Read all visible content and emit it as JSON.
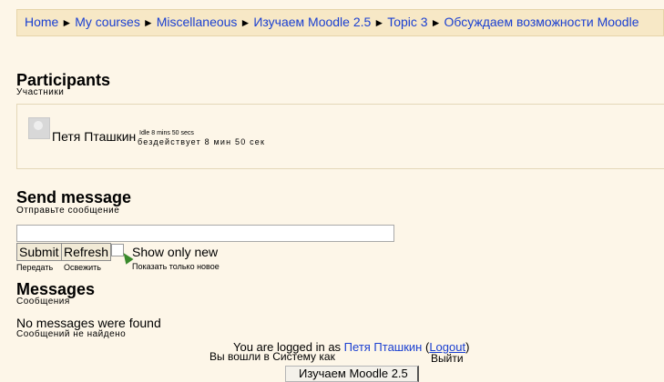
{
  "breadcrumb": {
    "items": [
      "Home",
      "My courses",
      "Miscellaneous",
      "Изучаем Moodle 2.5",
      "Topic 3",
      "Обсуждаем возможности Moodle"
    ],
    "separator": "►"
  },
  "participants": {
    "title": "Participants",
    "subtitle": "Участники",
    "users": [
      {
        "name": "Петя Пташкин",
        "idle": "Idle 8 mins 50 secs",
        "idle_ru": "бездействует 8 мин 50 сек"
      }
    ]
  },
  "send_message": {
    "title": "Send message",
    "subtitle": "Отправьте сообщение",
    "input_value": "",
    "submit_label": "Submit",
    "submit_sub": "Передать",
    "refresh_label": "Refresh",
    "refresh_sub": "Освежить",
    "show_only_new_label": "Show only new",
    "show_only_new_sub": "Показать только новое",
    "show_only_new_checked": false
  },
  "messages": {
    "title": "Messages",
    "subtitle": "Сообщения",
    "empty_text": "No messages were found",
    "empty_text_ru": "Сообщений не найдено"
  },
  "footer": {
    "logged_in_prefix": "You are logged in as ",
    "user_name": "Петя Пташкин",
    "logout_label": "Logout",
    "logged_in_ru": "Вы вошли в Систему как",
    "logout_ru": "Выйти",
    "course_button": "Изучаем Moodle 2.5"
  },
  "colors": {
    "link": "#1a3fd1",
    "background": "#fdf6e8",
    "breadcrumb_bg": "#f7e8c6"
  }
}
